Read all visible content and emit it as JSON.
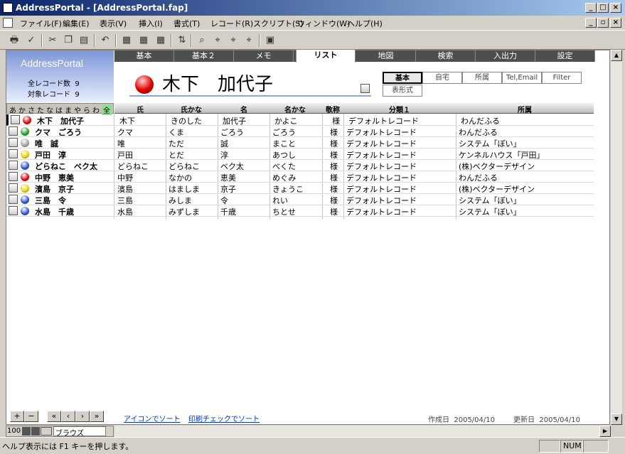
{
  "window": {
    "title": "AddressPortal - [AddressPortal.fap]"
  },
  "menu": [
    "ファイル(F)",
    "編集(E)",
    "表示(V)",
    "挿入(I)",
    "書式(T)",
    "レコード(R)",
    "スクリプト(S)",
    "ウィンドウ(W)",
    "ヘルプ(H)"
  ],
  "logo": {
    "name": "AddressPortal",
    "total_label": "全レコード数",
    "total": "9",
    "target_label": "対象レコード",
    "target": "9"
  },
  "tabs": [
    "基本",
    "基本２",
    "メモ",
    "リスト",
    "地図",
    "検索",
    "入出力",
    "設定"
  ],
  "active_tab": "リスト",
  "current_record": {
    "name": "木下　加代子"
  },
  "view_tabs": [
    "基本",
    "自宅",
    "所属",
    "Tel,Email",
    "Filter"
  ],
  "view_tab_extra": "表形式",
  "kana": [
    "あ",
    "か",
    "さ",
    "た",
    "な",
    "は",
    "ま",
    "や",
    "ら",
    "わ",
    "全"
  ],
  "headers": {
    "sei": "氏",
    "seikana": "氏かな",
    "mei": "名",
    "meikana": "名かな",
    "keisho": "敬称",
    "bunrui": "分類１",
    "shozoku": "所属"
  },
  "records": [
    {
      "name": "木下　加代子",
      "color": "#e00000",
      "sei": "木下",
      "seikana": "きのした",
      "mei": "加代子",
      "meikana": "かよこ",
      "keisho": "様",
      "bunrui": "デフォルトレコード",
      "shozoku": "わんだふる"
    },
    {
      "name": "クマ　ごろう",
      "color": "#20a020",
      "sei": "クマ",
      "seikana": "くま",
      "mei": "ごろう",
      "meikana": "ごろう",
      "keisho": "様",
      "bunrui": "デフォルトレコード",
      "shozoku": "わんだふる"
    },
    {
      "name": "唯　誠",
      "color": "#a0a0a0",
      "sei": "唯",
      "seikana": "ただ",
      "mei": "誠",
      "meikana": "まこと",
      "keisho": "様",
      "bunrui": "デフォルトレコード",
      "shozoku": "システム「ぽい」"
    },
    {
      "name": "戸田　淳",
      "color": "#e8d000",
      "sei": "戸田",
      "seikana": "とだ",
      "mei": "淳",
      "meikana": "あつし",
      "keisho": "様",
      "bunrui": "デフォルトレコード",
      "shozoku": "ケンネルハウス「戸田」"
    },
    {
      "name": "どらねこ　ベク太",
      "color": "#2050e0",
      "sei": "どらねこ",
      "seikana": "どらねこ",
      "mei": "ベク太",
      "meikana": "べくた",
      "keisho": "様",
      "bunrui": "デフォルトレコード",
      "shozoku": "(株)ベクターデザイン"
    },
    {
      "name": "中野　恵美",
      "color": "#e00000",
      "sei": "中野",
      "seikana": "なかの",
      "mei": "恵美",
      "meikana": "めぐみ",
      "keisho": "様",
      "bunrui": "デフォルトレコード",
      "shozoku": "わんだふる"
    },
    {
      "name": "濱島　京子",
      "color": "#e8d000",
      "sei": "濱島",
      "seikana": "はましま",
      "mei": "京子",
      "meikana": "きょうこ",
      "keisho": "様",
      "bunrui": "デフォルトレコード",
      "shozoku": "(株)ベクターデザイン"
    },
    {
      "name": "三島　令",
      "color": "#2050e0",
      "sei": "三島",
      "seikana": "みしま",
      "mei": "令",
      "meikana": "れい",
      "keisho": "様",
      "bunrui": "デフォルトレコード",
      "shozoku": "システム「ぽい」"
    },
    {
      "name": "水島　千歳",
      "color": "#2050e0",
      "sei": "水島",
      "seikana": "みずしま",
      "mei": "千歳",
      "meikana": "ちとせ",
      "keisho": "様",
      "bunrui": "デフォルトレコード",
      "shozoku": "システム「ぽい」"
    }
  ],
  "footer": {
    "sort_icon": "アイコンでソート",
    "sort_print": "印刷チェックでソート",
    "created_label": "作成日",
    "created": "2005/04/10",
    "updated_label": "更新日",
    "updated": "2005/04/10"
  },
  "zoom": "100",
  "mode": "ブラウズ",
  "status": {
    "help": "ヘルプ表示には F1 キーを押します。",
    "num": "NUM"
  }
}
